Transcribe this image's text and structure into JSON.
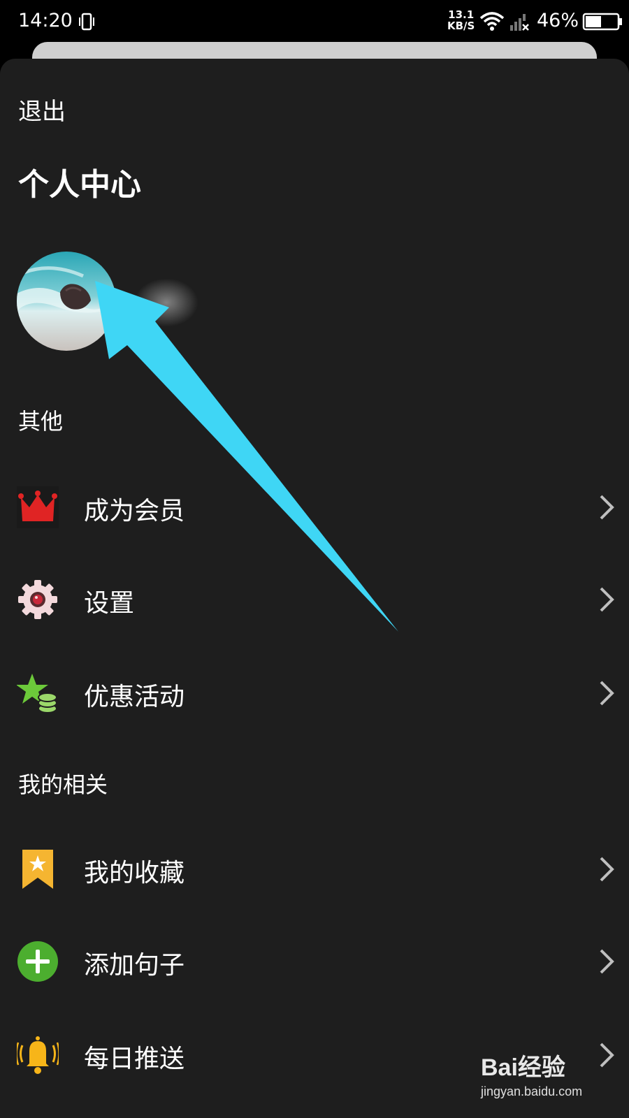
{
  "status_bar": {
    "time": "14:20",
    "net_speed_value": "13.1",
    "net_speed_unit": "KB/S",
    "battery_percent": "46%",
    "icons": [
      "vibrate-icon",
      "wifi-icon",
      "signal-off-icon",
      "battery-icon"
    ]
  },
  "header": {
    "exit_label": "退出",
    "title": "个人中心"
  },
  "sections": {
    "other": "其他",
    "mine": "我的相关"
  },
  "menu": {
    "vip": {
      "label": "成为会员",
      "icon": "crown-icon",
      "color": "#e02424"
    },
    "settings": {
      "label": "设置",
      "icon": "gear-icon",
      "color": "#f3d9dc"
    },
    "promo": {
      "label": "优惠活动",
      "icon": "star-coins-icon",
      "color": "#6cc93a"
    },
    "favorites": {
      "label": "我的收藏",
      "icon": "bookmark-star-icon",
      "color": "#f5b531"
    },
    "add_sentence": {
      "label": "添加句子",
      "icon": "plus-circle-icon",
      "color": "#4cae2f"
    },
    "daily_push": {
      "label": "每日推送",
      "icon": "bell-icon",
      "color": "#f7b519"
    }
  },
  "overlay": {
    "arrow_color": "#3fd6f5"
  },
  "watermark": {
    "logo": "Bai经验",
    "url": "jingyan.baidu.com"
  }
}
